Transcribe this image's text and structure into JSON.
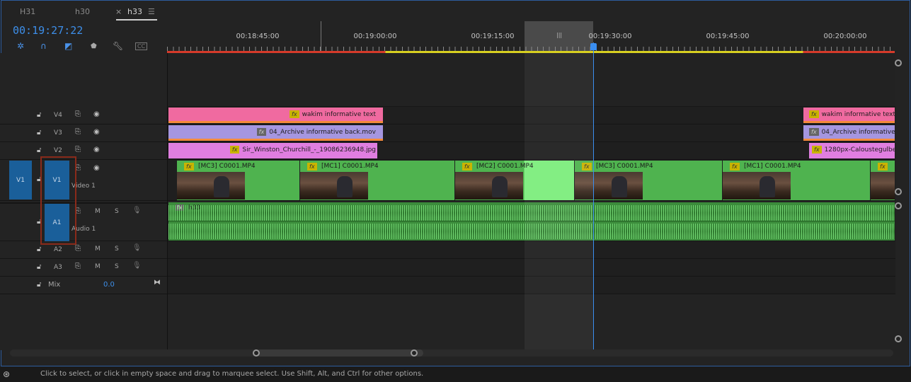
{
  "tabs": [
    {
      "label": "H31"
    },
    {
      "label": "h30"
    },
    {
      "label": "h33",
      "close_glyph": "×",
      "menu_glyph": "☰"
    }
  ],
  "timecode": "00:19:27:22",
  "tools": [
    "snap-icon",
    "linked-selection-icon",
    "add-marker-icon",
    "marker-icon",
    "settings-wrench-icon",
    "captions-icon"
  ],
  "ruler": {
    "labels": [
      "00:18:45:00",
      "00:19:00:00",
      "00:19:15:00",
      "00:19:30:00",
      "00:19:45:00",
      "00:20:00:00"
    ],
    "work_area_handle": "|||"
  },
  "tracks": {
    "video": [
      {
        "id": "V4",
        "toggle_icons": [
          "lock-icon",
          "film-icon",
          "eye-icon"
        ]
      },
      {
        "id": "V3",
        "toggle_icons": [
          "lock-icon",
          "film-icon",
          "eye-icon"
        ]
      },
      {
        "id": "V2",
        "toggle_icons": [
          "lock-icon",
          "film-icon",
          "eye-icon"
        ]
      },
      {
        "id": "V1",
        "name": "Video 1",
        "source": "V1"
      }
    ],
    "audio": [
      {
        "id": "A1",
        "name": "Audio 1",
        "m": "M",
        "s": "S"
      },
      {
        "id": "A2",
        "m": "M",
        "s": "S"
      },
      {
        "id": "A3",
        "m": "M",
        "s": "S"
      }
    ],
    "mix": {
      "label": "Mix",
      "value": "0.0"
    }
  },
  "clips": {
    "v4": [
      "wakim informative text",
      "wakim informative text"
    ],
    "v3": [
      "04_Archive informative back.mov",
      "04_Archive informative"
    ],
    "v2": [
      "Sir_Winston_Churchill_-_19086236948.jpg",
      "1280px-Caloustegulbe"
    ],
    "v1": [
      "[MC3] C0001.MP4",
      "[MC1] C0001.MP4",
      "[MC2] C0001.MP4",
      "[MC3] C0001.MP4",
      "[MC1] C0001.MP4"
    ],
    "a1": "h33",
    "fx_label": "fx"
  },
  "colors": {
    "v4": "#f06aa0",
    "v3": "#a596e0",
    "v2": "#e07ee0",
    "v1": "#4fb34f",
    "a1": "#3b8c3b",
    "playhead": "#3a8ef0",
    "timecode": "#3d8ee8"
  },
  "status": "Click to select, or click in empty space and drag to marquee select. Use Shift, Alt, and Ctrl for other options."
}
